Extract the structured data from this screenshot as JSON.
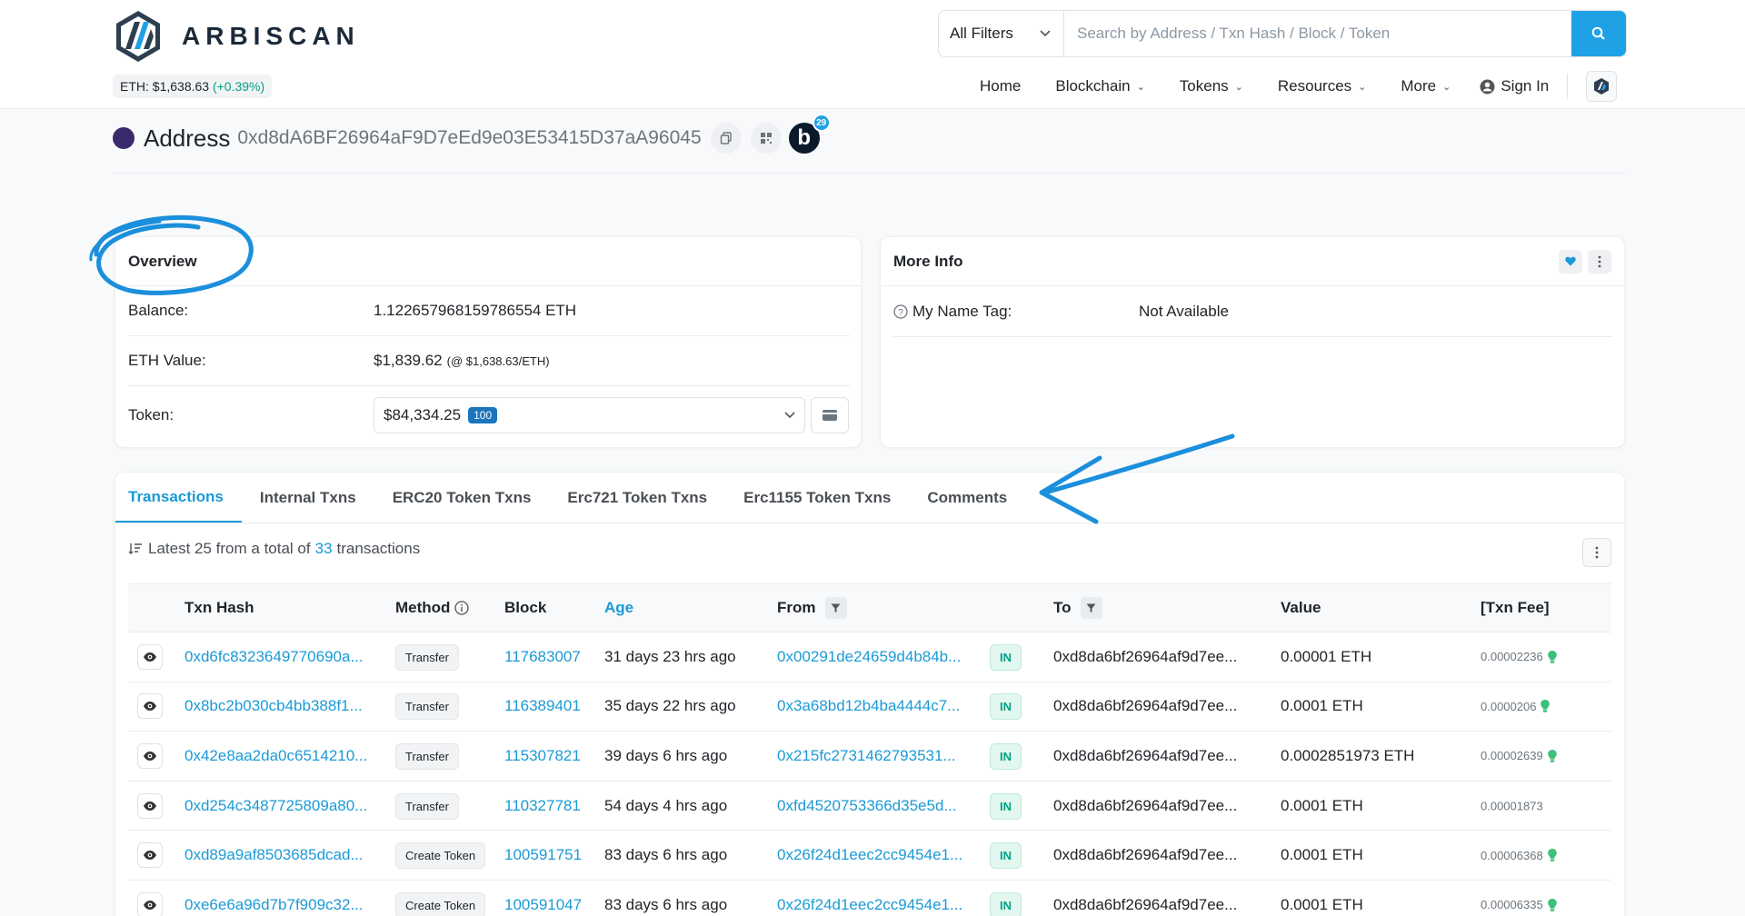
{
  "header": {
    "brand": "ARBISCAN",
    "eth_price_label": "ETH: $1,638.63",
    "eth_price_change": "(+0.39%)",
    "filter_label": "All Filters",
    "search_placeholder": "Search by Address / Txn Hash / Block / Token",
    "nav": [
      {
        "label": "Home",
        "caret": false
      },
      {
        "label": "Blockchain",
        "caret": true
      },
      {
        "label": "Tokens",
        "caret": true
      },
      {
        "label": "Resources",
        "caret": true
      },
      {
        "label": "More",
        "caret": true
      }
    ],
    "sign_in": "Sign In"
  },
  "address": {
    "title": "Address",
    "hash": "0xd8dA6BF26964aF9D7eEd9e03E53415D37aA96045",
    "blockscan_count": "29"
  },
  "overview": {
    "title": "Overview",
    "balance_label": "Balance:",
    "balance_value": "1.122657968159786554 ETH",
    "eth_value_label": "ETH Value:",
    "eth_value": "$1,839.62",
    "eth_value_sub": "(@ $1,638.63/ETH)",
    "token_label": "Token:",
    "token_value": "$84,334.25",
    "token_count": "100"
  },
  "more_info": {
    "title": "More Info",
    "name_tag_label": "My Name Tag:",
    "name_tag_value": "Not Available"
  },
  "tabs": [
    "Transactions",
    "Internal Txns",
    "ERC20 Token Txns",
    "Erc721 Token Txns",
    "Erc1155 Token Txns",
    "Comments"
  ],
  "summary": {
    "prefix": "Latest 25 from a total of",
    "total": "33",
    "suffix": "transactions"
  },
  "table": {
    "headers": {
      "txn_hash": "Txn Hash",
      "method": "Method",
      "block": "Block",
      "age": "Age",
      "from": "From",
      "to": "To",
      "value": "Value",
      "fee": "[Txn Fee]"
    },
    "rows": [
      {
        "hash": "0xd6fc8323649770690a...",
        "method": "Transfer",
        "block": "117683007",
        "age": "31 days 23 hrs ago",
        "from": "0x00291de24659d4b84b...",
        "dir": "IN",
        "to": "0xd8da6bf26964af9d7ee...",
        "value": "0.00001 ETH",
        "fee": "0.00002236"
      },
      {
        "hash": "0x8bc2b030cb4bb388f1...",
        "method": "Transfer",
        "block": "116389401",
        "age": "35 days 22 hrs ago",
        "from": "0x3a68bd12b4ba4444c7...",
        "dir": "IN",
        "to": "0xd8da6bf26964af9d7ee...",
        "value": "0.0001 ETH",
        "fee": "0.0000206"
      },
      {
        "hash": "0x42e8aa2da0c6514210...",
        "method": "Transfer",
        "block": "115307821",
        "age": "39 days 6 hrs ago",
        "from": "0x215fc2731462793531...",
        "dir": "IN",
        "to": "0xd8da6bf26964af9d7ee...",
        "value": "0.0002851973 ETH",
        "fee": "0.00002639"
      },
      {
        "hash": "0xd254c3487725809a80...",
        "method": "Transfer",
        "block": "110327781",
        "age": "54 days 4 hrs ago",
        "from": "0xfd4520753366d35e5d...",
        "dir": "IN",
        "to": "0xd8da6bf26964af9d7ee...",
        "value": "0.0001 ETH",
        "fee": "0.00001873"
      },
      {
        "hash": "0xd89a9af8503685dcad...",
        "method": "Create Token",
        "block": "100591751",
        "age": "83 days 6 hrs ago",
        "from": "0x26f24d1eec2cc9454e1...",
        "dir": "IN",
        "to": "0xd8da6bf26964af9d7ee...",
        "value": "0.0001 ETH",
        "fee": "0.00006368"
      },
      {
        "hash": "0xe6e6a96d7b7f909c32...",
        "method": "Create Token",
        "block": "100591047",
        "age": "83 days 6 hrs ago",
        "from": "0x26f24d1eec2cc9454e1...",
        "dir": "IN",
        "to": "0xd8da6bf26964af9d7ee...",
        "value": "0.0001 ETH",
        "fee": "0.00006335"
      }
    ]
  },
  "colors": {
    "accent": "#1b9ad6",
    "search_button": "#1fa2e5",
    "in_badge": "#00a186",
    "annotation": "#1b8fdc"
  }
}
